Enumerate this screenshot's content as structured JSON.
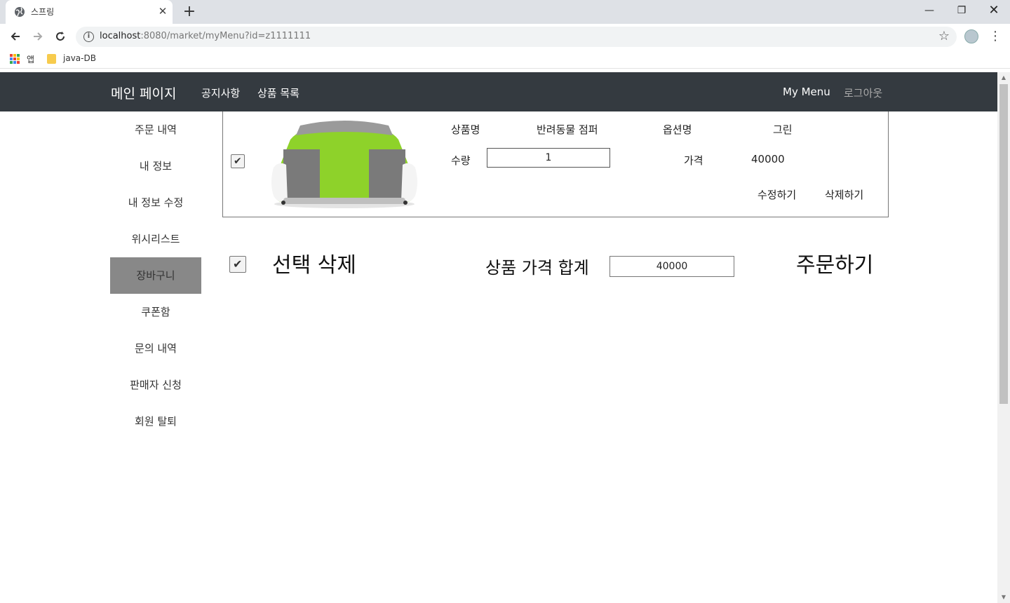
{
  "browser": {
    "tab_title": "스프링",
    "url_host": "localhost",
    "url_rest": ":8080/market/myMenu?id=z1111111",
    "bookmarks": [
      {
        "label": "앱",
        "icon": "apps-grid-icon"
      },
      {
        "label": "java-DB",
        "icon": "folder-icon"
      }
    ]
  },
  "navbar": {
    "brand": "메인 페이지",
    "links": [
      "공지사항",
      "상품 목록"
    ],
    "my_menu": "My Menu",
    "logout": "로그아웃"
  },
  "sidebar": {
    "items": [
      "주문 내역",
      "내 정보",
      "내 정보 수정",
      "위시리스트",
      "장바구니",
      "쿠폰함",
      "문의 내역",
      "판매자 신청",
      "회원 탈퇴"
    ],
    "active": "장바구니",
    "active_bg": "#888888"
  },
  "cart_item": {
    "checked": true,
    "product_label": "상품명",
    "product_name": "반려동물 점퍼",
    "option_label": "옵션명",
    "option_value": "그린",
    "qty_label": "수량",
    "qty_value": "1",
    "price_label": "가격",
    "price_value": "40000",
    "edit_button": "수정하기",
    "delete_button": "삭제하기"
  },
  "summary": {
    "select_delete": "선택 삭제",
    "total_label": "상품 가격 합계",
    "total_value": "40000",
    "order_button": "주문하기"
  },
  "colors": {
    "navbar_bg": "#343a40",
    "jacket_green": "#8ed22a",
    "jacket_gray": "#7a7a7a"
  }
}
